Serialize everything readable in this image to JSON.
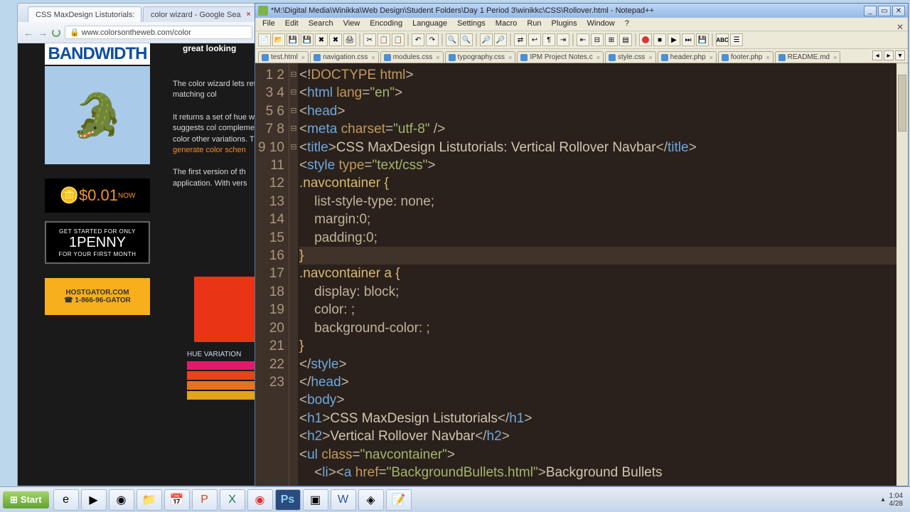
{
  "browser": {
    "tabs": [
      {
        "label": "CSS MaxDesign Listutorials:"
      },
      {
        "label": "color wizard - Google Sea"
      }
    ],
    "url": "www.colorsontheweb.com/color",
    "great": "great looking",
    "promo": {
      "bandwidth": "BANDWIDTH",
      "penny_now": "$0.01",
      "penny_small_top": "GET STARTED FOR ONLY",
      "penny_big": "1PENNY",
      "penny_small_bot": "FOR YOUR FIRST MONTH",
      "hostgator": "HOSTGATOR.COM",
      "phone": "☎ 1-866-96-GATOR"
    },
    "bodytext": {
      "p1": "The color wizard lets returns matching col",
      "p2a": "It returns a set of hue well as suggests col complementary color other variations. The ",
      "scheme": "generate color schen",
      "p3": "The first version of th application. With vers"
    },
    "huevar": "HUE VARIATION",
    "hues": [
      "#e21a6c",
      "#e2471a",
      "#e2751a",
      "#e2a31a"
    ]
  },
  "npp": {
    "title": "*M:\\Digital Media\\Winikka\\Web Design\\Student Folders\\Day 1 Period 3\\winikkc\\CSS\\Rollover.html - Notepad++",
    "menu": [
      "File",
      "Edit",
      "Search",
      "View",
      "Encoding",
      "Language",
      "Settings",
      "Macro",
      "Run",
      "Plugins",
      "Window",
      "?"
    ],
    "tabs": [
      {
        "name": "test.html",
        "mod": false
      },
      {
        "name": "navigation.css",
        "mod": false
      },
      {
        "name": "modules.css",
        "mod": false
      },
      {
        "name": "typography.css",
        "mod": false
      },
      {
        "name": "IPM Project Notes.c",
        "mod": false
      },
      {
        "name": "style.css",
        "mod": false
      },
      {
        "name": "header.php",
        "mod": false
      },
      {
        "name": "footer.php",
        "mod": false
      },
      {
        "name": "README.md",
        "mod": false
      }
    ],
    "code": {
      "l1_decl": "DOCTYPE html",
      "l2_tag": "html",
      "l2_attr": "lang",
      "l2_val": "\"en\"",
      "l3": "head",
      "l4_tag": "meta",
      "l4_attr": "charset",
      "l4_val": "\"utf-8\"",
      "l5_tag": "title",
      "l5_text": "CSS MaxDesign Listutorials: Vertical Rollover Navbar",
      "l6_tag": "style",
      "l6_attr": "type",
      "l6_val": "\"text/css\"",
      "l7_sel": ".navcontainer {",
      "l8": "    list-style-type: none;",
      "l9": "    margin:0;",
      "l10": "    padding:0;",
      "l11": "}",
      "l12_sel": ".navcontainer a {",
      "l13": "    display: block;",
      "l14": "    color: ;",
      "l15": "    background-color: ;",
      "l16": "}",
      "l17": "style",
      "l18": "head",
      "l19": "body",
      "l20_tag": "h1",
      "l20_text": "CSS MaxDesign Listutorials",
      "l21_tag": "h2",
      "l21_text": "Vertical Rollover Navbar",
      "l22_tag": "ul",
      "l22_attr": "class",
      "l22_val": "\"navcontainer\"",
      "l23_tag1": "li",
      "l23_tag2": "a",
      "l23_attr": "href",
      "l23_val": "\"BackgroundBullets.html\"",
      "l23_text": "Background Bullets"
    }
  },
  "taskbar": {
    "start": "Start",
    "time": "1:04",
    "date": "4/28"
  }
}
